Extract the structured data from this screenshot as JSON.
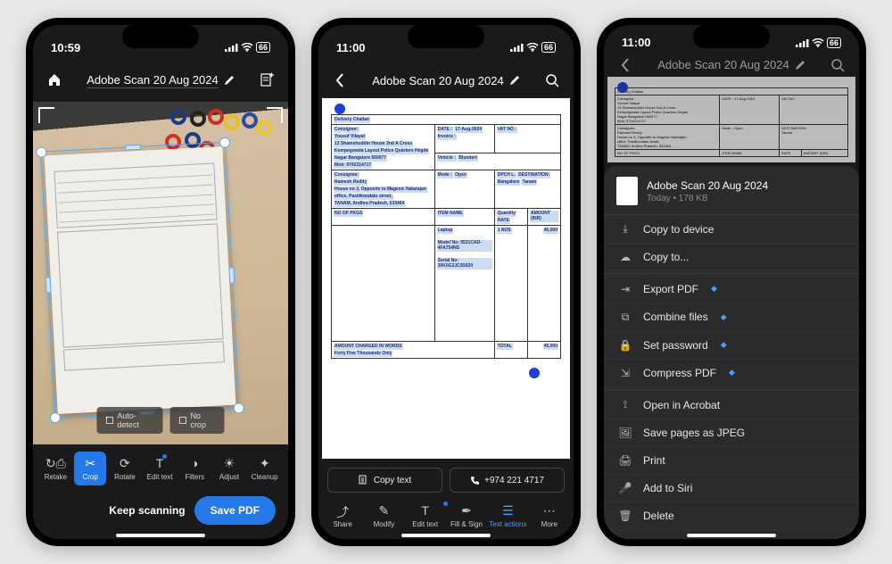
{
  "status": {
    "time1": "10:59",
    "time2": "11:00",
    "battery": "66"
  },
  "header": {
    "title": "Adobe Scan 20 Aug 2024"
  },
  "phone1": {
    "crop_actions": {
      "auto": "Auto-detect",
      "nocrop": "No crop"
    },
    "tools": {
      "retake": "Retake",
      "crop": "Crop",
      "rotate": "Rotate",
      "edittext": "Edit text",
      "filters": "Filters",
      "adjust": "Adjust",
      "cleanup": "Cleanup"
    },
    "keep_scanning": "Keep scanning",
    "save_pdf": "Save PDF"
  },
  "phone2": {
    "copy_text": "Copy text",
    "phone": "+974 221 4717",
    "tools": {
      "share": "Share",
      "modify": "Modify",
      "edittext": "Edit text",
      "fillsign": "Fill & Sign",
      "textactions": "Text actions",
      "more": "More"
    },
    "doc": {
      "header": "Delivery Challan",
      "consignor_label": "Consignor:",
      "consignor_name": "Yousuf Vilayat",
      "addr1": "13 Shamshuddin House 2nd A Cross",
      "addr2": "Kempegowda Layout Police Quarters Hegde",
      "addr3": "Nagar Bangalore 560077",
      "mob": "Mob: 9742214717",
      "date_label": "DATE :",
      "date": "17-Aug-2024",
      "invoice_label": "Invoice :",
      "vat_label": "VAT NO :",
      "veh_label": "Vehicle :",
      "veh": "Blundert",
      "consignee_label": "Consignee:",
      "consignee_name": "Ramesh Reddy",
      "caddr1": "House no 3, Opposite to Magesic Natarajan",
      "caddr2": "office, Pasilikondalu street,",
      "caddr3": "TANAM, Andhra Pradesh, 533464",
      "mode_label": "Mode :",
      "mode": "Open",
      "dpch_label": "DPCH L.",
      "dest": "DESTINATION:",
      "dest_val": "Tanam",
      "bang": "Bangalore",
      "col_no": "NO OF PKGS",
      "col_item": "ITEM NAME",
      "col_qty": "Quantity",
      "col_rate": "RATE",
      "col_amt": "AMOUNT (INR)",
      "item": "Laptop",
      "qty": "1 NOS",
      "amt": "45,000",
      "model": "Model No: 5521CAD-4FA754NS",
      "serial": "Serial No: 30K0G3JCS5020",
      "words_label": "AMOUNT CHARGED IN WORDS",
      "words": "Forty Five Thousands Only",
      "total_label": "TOTAL",
      "total": "45,000"
    }
  },
  "phone3": {
    "sheet_title": "Adobe Scan 20 Aug 2024",
    "sheet_sub": "Today • 178 KB",
    "menu": {
      "copy_device": "Copy to device",
      "copy_to": "Copy to...",
      "export_pdf": "Export PDF",
      "combine": "Combine files",
      "password": "Set password",
      "compress": "Compress PDF",
      "acrobat": "Open in Acrobat",
      "save_jpeg": "Save pages as JPEG",
      "print": "Print",
      "siri": "Add to Siri",
      "delete": "Delete"
    }
  }
}
